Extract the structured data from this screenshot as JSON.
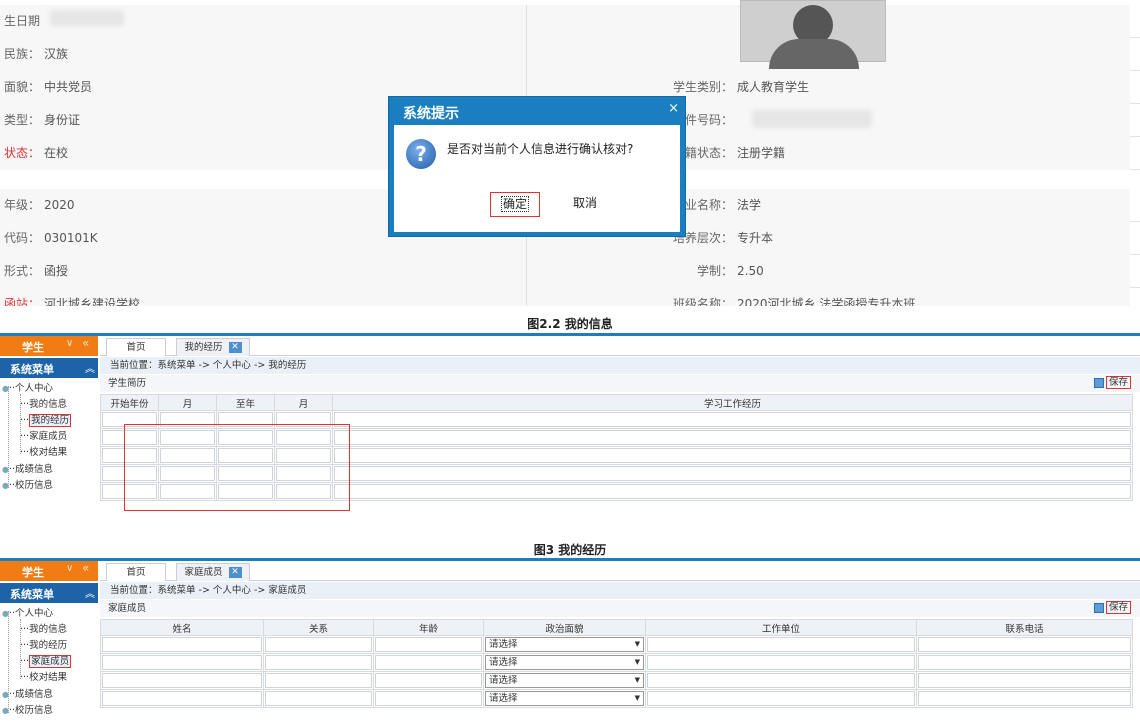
{
  "info": {
    "rows": [
      {
        "label": "生日期",
        "value": "",
        "red": false
      },
      {
        "label": "民族：",
        "value": "汉族",
        "red": false
      },
      {
        "label": "面貌：",
        "value": "中共党员",
        "red": false,
        "rlabel": "学生类别：",
        "rvalue": "成人教育学生"
      },
      {
        "label": "类型：",
        "value": "身份证",
        "red": false,
        "rlabel": "件号码：",
        "rvalue": ""
      },
      {
        "label": "状态：",
        "value": "在校",
        "red": true,
        "rlabel": "籍状态：",
        "rvalue": "注册学籍",
        "rred": true
      },
      {
        "label": "年级：",
        "value": "2020",
        "red": false,
        "rlabel": "业名称：",
        "rvalue": "法学"
      },
      {
        "label": "代码：",
        "value": "030101K",
        "red": false,
        "rlabel": "培养层次：",
        "rvalue": "专升本"
      },
      {
        "label": "形式：",
        "value": "函授",
        "red": false,
        "rlabel": "学制：",
        "rvalue": "2.50"
      },
      {
        "label": "函站：",
        "value": "河北城乡建设学校",
        "red": true,
        "rlabel": "班级名称：",
        "rvalue": "2020河北城乡 法学函授专升本班",
        "rred": true
      }
    ]
  },
  "modal": {
    "title": "系统提示",
    "close": "×",
    "question_icon": "?",
    "message": "是否对当前个人信息进行确认核对?",
    "ok_label": "确定",
    "cancel_label": "取消"
  },
  "caption1": "图2.2 我的信息",
  "caption2": "图3 我的经历",
  "sidebar": {
    "role": "学生",
    "menu_title": "系统菜单",
    "root": "个人中心",
    "items": [
      "我的信息",
      "我的经历",
      "家庭成员",
      "校对结果"
    ],
    "groups": [
      "成绩信息",
      "校历信息"
    ]
  },
  "exp": {
    "tabs": [
      "首页",
      "我的经历"
    ],
    "crumb": "当前位置：系统菜单 -> 个人中心 -> 我的经历",
    "panel_title": "学生简历",
    "save_label": "保存",
    "columns": [
      "开始年份",
      "月",
      "至年",
      "月",
      "学习工作经历"
    ]
  },
  "fam": {
    "tabs": [
      "首页",
      "家庭成员"
    ],
    "crumb": "当前位置：系统菜单 -> 个人中心 -> 家庭成员",
    "panel_title": "家庭成员",
    "save_label": "保存",
    "columns": [
      "姓名",
      "关系",
      "年龄",
      "政治面貌",
      "工作单位",
      "联系电话"
    ],
    "select_placeholder": "请选择"
  },
  "colors": {
    "accent": "#1a7ec0",
    "orange": "#f07c13",
    "menu": "#1c63a8",
    "highlight": "#dd3333"
  }
}
